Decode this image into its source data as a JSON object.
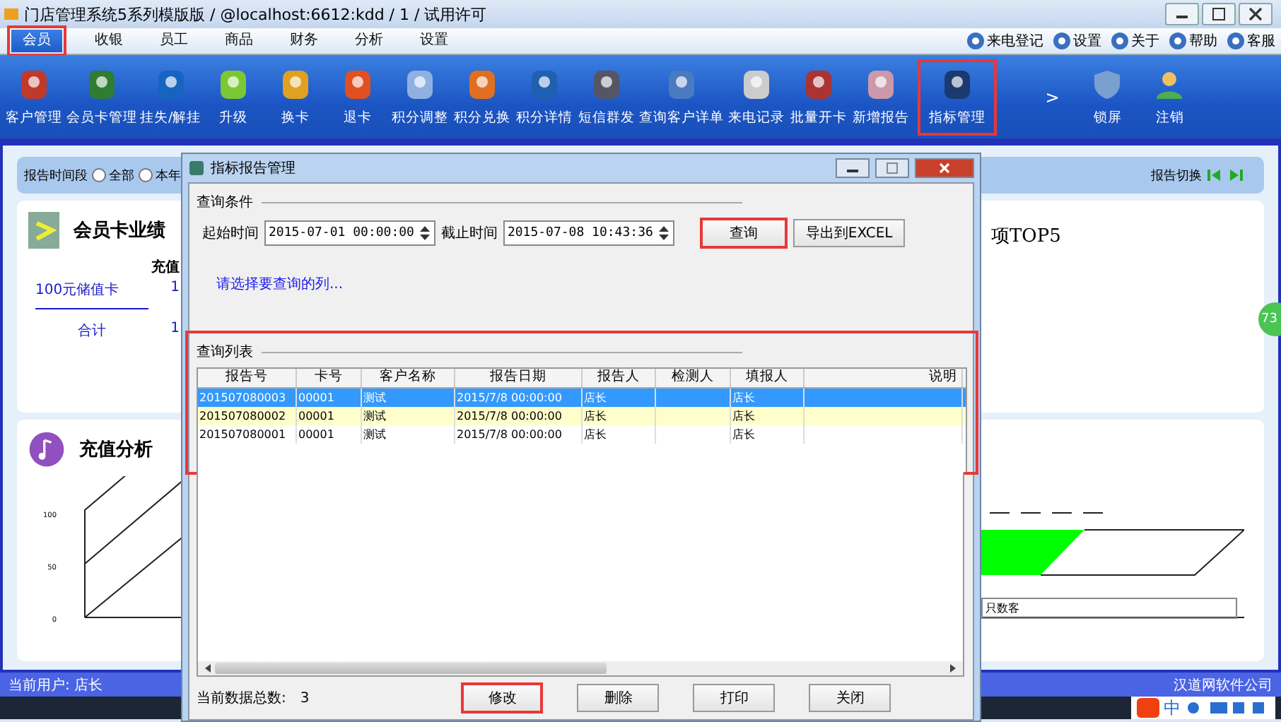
{
  "window": {
    "title": "门店管理系统5系列模版版 / @localhost:6612:kdd / 1 / 试用许可"
  },
  "menu_tabs": [
    {
      "label": "会员",
      "selected": true,
      "highlighted": true
    },
    {
      "label": "收银",
      "selected": false,
      "highlighted": false
    },
    {
      "label": "员工",
      "selected": false,
      "highlighted": false
    },
    {
      "label": "商品",
      "selected": false,
      "highlighted": false
    },
    {
      "label": "财务",
      "selected": false,
      "highlighted": false
    },
    {
      "label": "分析",
      "selected": false,
      "highlighted": false
    },
    {
      "label": "设置",
      "selected": false,
      "highlighted": false
    }
  ],
  "top_links": [
    "来电登记",
    "设置",
    "关于",
    "帮助",
    "客服"
  ],
  "toolbar": [
    {
      "label": "客户管理",
      "highlighted": false
    },
    {
      "label": "会员卡管理",
      "highlighted": false
    },
    {
      "label": "挂失/解挂",
      "highlighted": false
    },
    {
      "label": "升级",
      "highlighted": false
    },
    {
      "label": "换卡",
      "highlighted": false
    },
    {
      "label": "退卡",
      "highlighted": false
    },
    {
      "label": "积分调整",
      "highlighted": false
    },
    {
      "label": "积分兑换",
      "highlighted": false
    },
    {
      "label": "积分详情",
      "highlighted": false
    },
    {
      "label": "短信群发",
      "highlighted": false
    },
    {
      "label": "查询客户详单",
      "highlighted": false
    },
    {
      "label": "来电记录",
      "highlighted": false
    },
    {
      "label": "批量开卡",
      "highlighted": false
    },
    {
      "label": "新增报告",
      "highlighted": false
    },
    {
      "label": "指标管理",
      "highlighted": true
    }
  ],
  "toolbar_more": ">",
  "toolbar_right": [
    "锁屏",
    "注销"
  ],
  "report_bar": {
    "label": "报告时间段",
    "options": [
      {
        "label": "全部",
        "selected": false
      },
      {
        "label": "本年",
        "selected": false
      }
    ],
    "switch_label": "报告切换"
  },
  "card_performance": {
    "title": "会员卡业绩",
    "column": "充值",
    "rows": [
      {
        "name": "100元储值卡",
        "value": "1"
      }
    ],
    "total": {
      "label": "合计",
      "value": "1"
    }
  },
  "top5": {
    "title": "项TOP5"
  },
  "recharge": {
    "title": "充值分析",
    "axis_ticks": [
      "100",
      "50",
      "0"
    ],
    "legend": "只数客"
  },
  "side_badge": "73",
  "status_bar": {
    "user": "当前用户: 店长",
    "company": "汉道网软件公司",
    "ime": "中"
  },
  "dialog": {
    "title": "指标报告管理",
    "conditions": {
      "legend": "查询条件",
      "start_label": "起始时间",
      "start": "2015-07-01 00:00:00",
      "end_label": "截止时间",
      "end": "2015-07-08 10:43:36"
    },
    "top_buttons": [
      {
        "label": "查询",
        "highlighted": true
      },
      {
        "label": "导出到EXCEL",
        "highlighted": false
      }
    ],
    "column_link": "请选择要查询的列...",
    "list_legend": "查询列表",
    "list_highlighted": true,
    "table": {
      "columns": [
        "报告号",
        "卡号",
        "客户名称",
        "报告日期",
        "报告人",
        "检测人",
        "填报人",
        "说明"
      ],
      "rows": [
        {
          "report_no": "201507080003",
          "card_no": "00001",
          "customer": "测试",
          "date": "2015/7/8 00:00:00",
          "reporter": "店长",
          "filler": "店长",
          "selected": true
        },
        {
          "report_no": "201507080002",
          "card_no": "00001",
          "customer": "测试",
          "date": "2015/7/8 00:00:00",
          "reporter": "店长",
          "filler": "店长",
          "selected": false
        },
        {
          "report_no": "201507080001",
          "card_no": "00001",
          "customer": "测试",
          "date": "2015/7/8 00:00:00",
          "reporter": "店长",
          "filler": "店长",
          "selected": false
        }
      ]
    },
    "count_label": "当前数据总数:",
    "count": "3",
    "buttons": [
      {
        "label": "修改",
        "highlighted": true
      },
      {
        "label": "删除",
        "highlighted": false
      },
      {
        "label": "打印",
        "highlighted": false
      },
      {
        "label": "关闭",
        "highlighted": false
      }
    ]
  }
}
